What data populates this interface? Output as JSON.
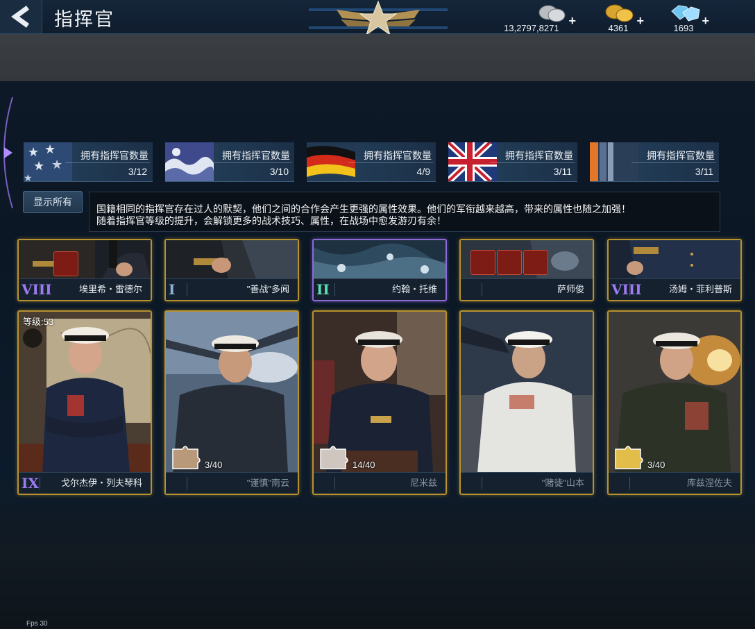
{
  "header": {
    "title": "指挥官",
    "currencies": [
      {
        "name": "silver",
        "value": "13,2797,8271"
      },
      {
        "name": "gold",
        "value": "4361"
      },
      {
        "name": "diamond",
        "value": "1693"
      }
    ]
  },
  "factions": [
    {
      "flag": "usa",
      "label": "拥有指挥官数量",
      "count": "3/12"
    },
    {
      "flag": "japan",
      "label": "拥有指挥官数量",
      "count": "3/10"
    },
    {
      "flag": "germany",
      "label": "拥有指挥官数量",
      "count": "4/9"
    },
    {
      "flag": "uk",
      "label": "拥有指挥官数量",
      "count": "3/11"
    },
    {
      "flag": "ussr",
      "label": "拥有指挥官数量",
      "count": "3/11"
    }
  ],
  "show_all_label": "显示所有",
  "info": {
    "line1": "国籍相同的指挥官存在过人的默契，他们之间的合作会产生更强的属性效果。他们的军衔越来越高，带来的属性也随之加强！",
    "line2": "随着指挥官等级的提升，会解锁更多的战术技巧、属性，在战场中愈发游刃有余！"
  },
  "top_row": [
    {
      "rank": "VIII",
      "name": "埃里希・雷德尔"
    },
    {
      "rank": "I",
      "name": "\"善战\"多闻"
    },
    {
      "rank": "II",
      "name": "约翰・托维"
    },
    {
      "rank": "",
      "name": "萨师俊"
    },
    {
      "rank": "VIII",
      "name": "汤姆・菲利普斯"
    }
  ],
  "bottom_row": [
    {
      "level": "等级:53",
      "rank": "IX",
      "name": "戈尔杰伊・列夫琴科",
      "fragments": ""
    },
    {
      "level": "",
      "rank": "",
      "name": "\"谨慎\"南云",
      "fragments": "3/40"
    },
    {
      "level": "",
      "rank": "",
      "name": "尼米兹",
      "fragments": "14/40"
    },
    {
      "level": "",
      "rank": "",
      "name": "\"赌徒\"山本",
      "fragments": ""
    },
    {
      "level": "",
      "rank": "",
      "name": "库兹涅佐夫",
      "fragments": "3/40"
    }
  ],
  "fps": "Fps 30",
  "colors": {
    "gold_border": "#b8922f",
    "purple_border": "#8d6bd6",
    "rank_purple": "#9d7bf0"
  }
}
